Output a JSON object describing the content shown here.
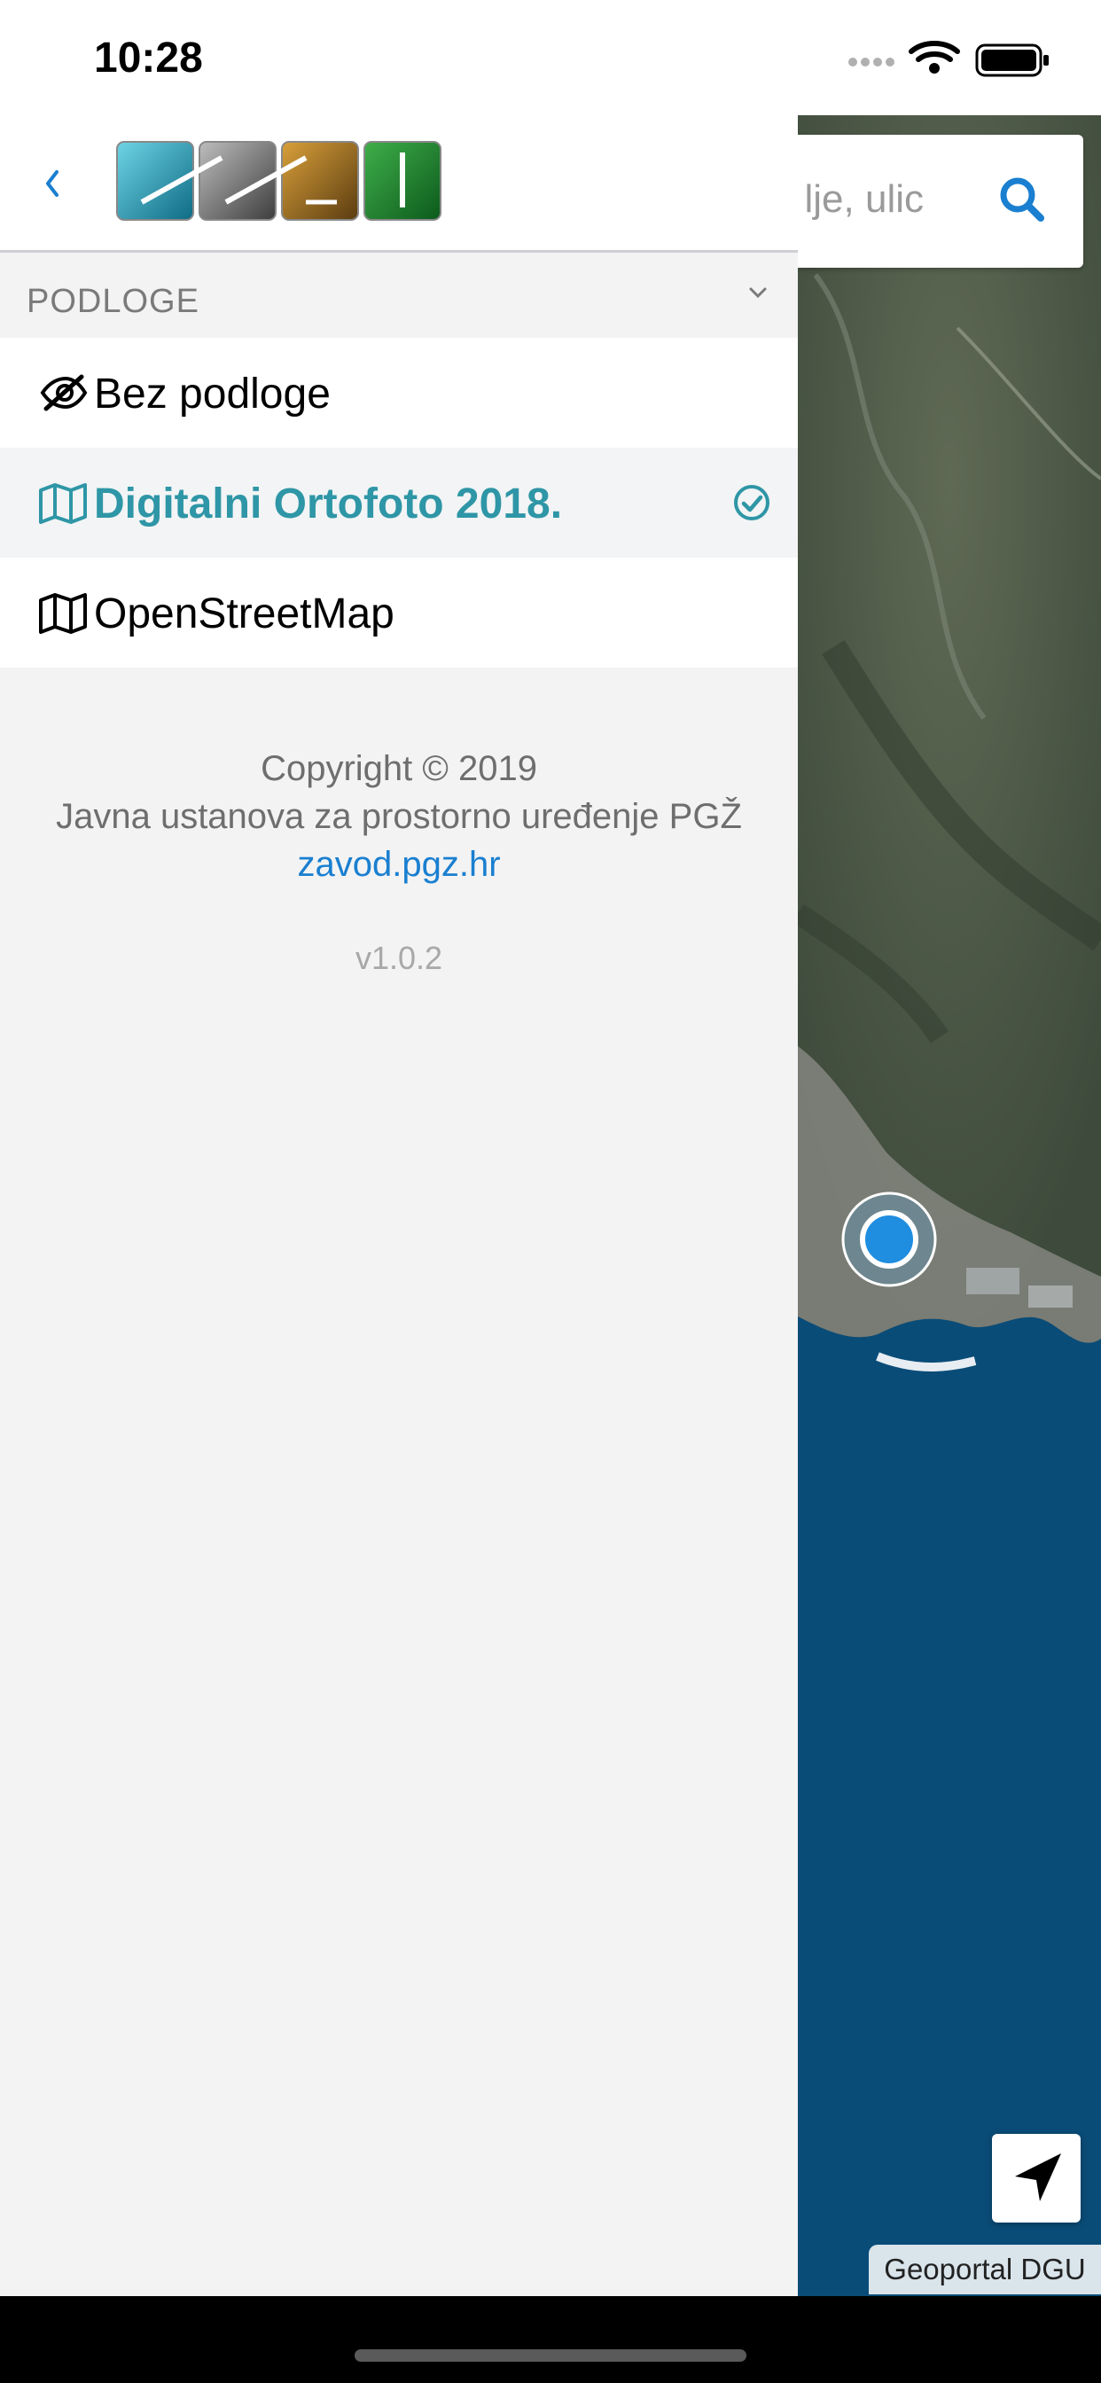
{
  "status_bar": {
    "time": "10:28"
  },
  "drawer": {
    "back_icon": "chevron-left-icon",
    "logo": "pgz-zavod-logo",
    "section": {
      "title": "PODLOGE",
      "chevron_icon": "chevron-down-icon"
    },
    "layers": [
      {
        "label": "Bez podloge",
        "icon": "eye-slash-icon",
        "selected": false
      },
      {
        "label": "Digitalni Ortofoto 2018.",
        "icon": "map-icon",
        "selected": true
      },
      {
        "label": "OpenStreetMap",
        "icon": "map-icon",
        "selected": false
      }
    ],
    "footer": {
      "copyright": "Copyright © 2019",
      "organization": "Javna ustanova za prostorno uređenje PGŽ",
      "link": "zavod.pgz.hr",
      "version": "v1.0.2"
    }
  },
  "map": {
    "search_text": "lje, ulic",
    "search_icon": "search-icon",
    "locate_icon": "location-arrow-icon",
    "attribution": "Geoportal DGU"
  },
  "colors": {
    "accent": "#2e96a6",
    "link": "#1a7fd0",
    "sea": "#0a4c78",
    "land": "#4f5a48"
  }
}
